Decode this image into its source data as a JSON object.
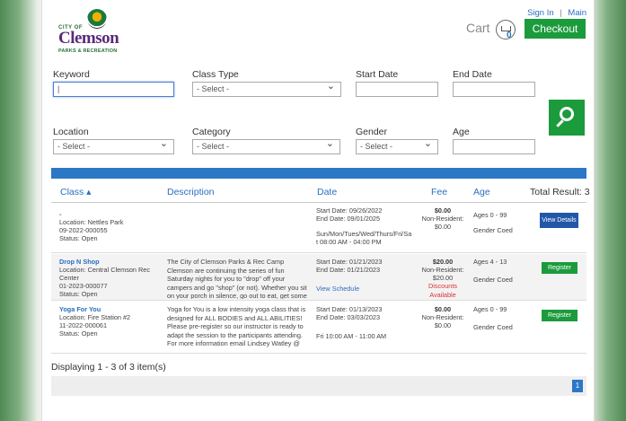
{
  "brand": {
    "city_of": "CITY OF",
    "name": "Clemson",
    "sub": "PARKS & RECREATION"
  },
  "header": {
    "sign_in": "Sign In",
    "separator": "|",
    "main": "Main",
    "cart_label": "Cart",
    "cart_count": "0",
    "checkout_label": "Checkout"
  },
  "filters": {
    "keyword_label": "Keyword",
    "keyword_value": "",
    "class_type_label": "Class Type",
    "class_type_value": "- Select -",
    "start_date_label": "Start Date",
    "start_date_value": "",
    "end_date_label": "End Date",
    "end_date_value": "",
    "location_label": "Location",
    "location_value": "- Select -",
    "category_label": "Category",
    "category_value": "- Select -",
    "gender_label": "Gender",
    "gender_value": "- Select -",
    "age_label": "Age",
    "age_value": ""
  },
  "table": {
    "headers": {
      "class": "Class ▴",
      "description": "Description",
      "date": "Date",
      "fee": "Fee",
      "age": "Age",
      "total": "Total Result: 3"
    },
    "rows": [
      {
        "title": "-",
        "location": "Location: Nettles Park",
        "code": "09-2022-000055",
        "status": "Status: Open",
        "desc": "",
        "start": "Start Date: 09/26/2022",
        "end": "End Date: 09/01/2025",
        "schedule": "Sun/Mon/Tues/Wed/Thurs/Fri/Sa",
        "schedule2": "t 08:00 AM - 04:00 PM",
        "fee": "$0.00",
        "nonres_label": "Non-Resident:",
        "nonres": "$0.00",
        "discount": "",
        "ages": "Ages 0 - 99",
        "gender": "Gender Coed",
        "action": "View Details"
      },
      {
        "title": "Drop N Shop",
        "location": "Location: Central Clemson Rec",
        "location2": "Center",
        "code": "01-2023-000077",
        "status": "Status: Open",
        "desc": "The City of Clemson Parks & Rec Camp Clemson are continuing the series of fun Saturday nights for you to \"drop\" off your campers and go \"shop\" (or not). Whether you sit on your porch in silence, go out to eat, get some groceries, or",
        "start": "Start Date: 01/21/2023",
        "end": "End Date: 01/21/2023",
        "schedule": "View Schedule",
        "fee": "$20.00",
        "nonres_label": "Non-Resident:",
        "nonres": "$20.00",
        "discount": "Discounts Available",
        "ages": "Ages 4 - 13",
        "gender": "Gender Coed",
        "action": "Register"
      },
      {
        "title": "Yoga For You",
        "location": "Location: Fire Station #2",
        "code": "11-2022-000061",
        "status": "Status: Open",
        "desc": "Yoga for You is a low intensity yoga class that is designed for ALL BODIES and ALL ABILITIES! Please pre-register so our instructor is ready to adapt the session to the participants attending. For more information email Lindsey Watley @",
        "start": "Start Date: 01/13/2023",
        "end": "End Date: 03/03/2023",
        "schedule": "Fri 10:00 AM - 11:00 AM",
        "fee": "$0.00",
        "nonres_label": "Non-Resident:",
        "nonres": "$0.00",
        "discount": "",
        "ages": "Ages 0 - 99",
        "gender": "Gender Coed",
        "action": "Register"
      }
    ]
  },
  "footer": {
    "displaying": "Displaying 1 - 3 of 3 item(s)",
    "page": "1"
  },
  "colors": {
    "accent_green": "#1b9b3c",
    "accent_blue": "#2d77c7",
    "link": "#2a6fc0"
  }
}
